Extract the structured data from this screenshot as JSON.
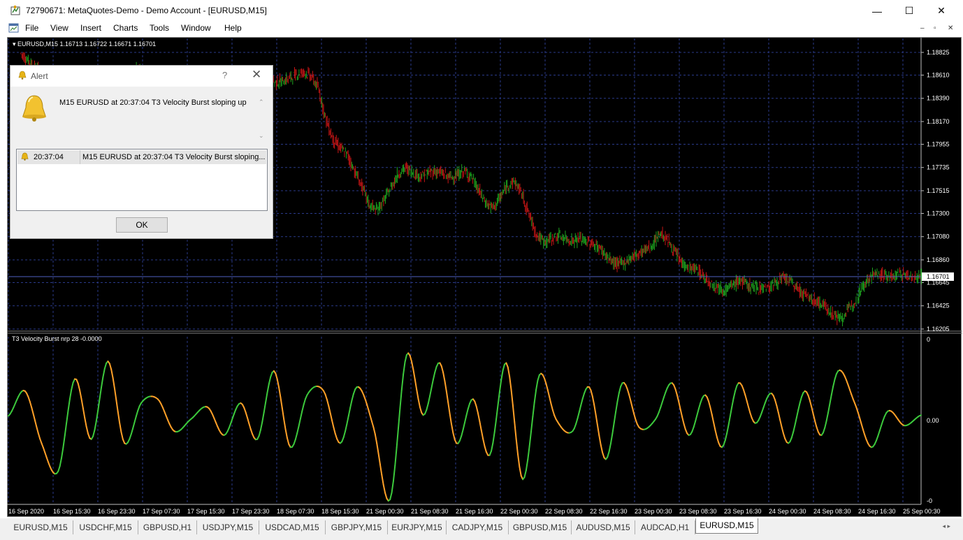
{
  "window": {
    "title": "72790671: MetaQuotes-Demo - Demo Account - [EURUSD,M15]",
    "minimize_glyph": "—",
    "maximize_glyph": "☐",
    "close_glyph": "✕"
  },
  "menu": {
    "items": [
      "File",
      "View",
      "Insert",
      "Charts",
      "Tools",
      "Window",
      "Help"
    ],
    "mdi": {
      "minimize": "–",
      "restore": "▫",
      "close": "✕"
    }
  },
  "chart": {
    "price_label": "EURUSD,M15  1.16713 1.16722 1.16671 1.16701",
    "current_price": "1.16701",
    "indicator_label": "T3 Velocity Burst nrp 28 -0.0000",
    "colors": {
      "background": "#000000",
      "bull": "#1ea51e",
      "bear": "#c71515",
      "grid": "#2a3a8a",
      "osc_up": "#3cc93c",
      "osc_down": "#ffa028"
    }
  },
  "chart_data": [
    {
      "type": "line",
      "title": "EURUSD,M15  1.16713 1.16722 1.16671 1.16701",
      "y_ticks": [
        "1.18825",
        "1.18610",
        "1.18390",
        "1.18170",
        "1.17955",
        "1.17735",
        "1.17515",
        "1.17300",
        "1.17080",
        "1.16860",
        "1.16645",
        "1.16425",
        "1.16205"
      ],
      "ylim": [
        1.16205,
        1.18825
      ],
      "current_price": 1.16701,
      "x_ticks": [
        "16 Sep 2020",
        "16 Sep 15:30",
        "16 Sep 23:30",
        "17 Sep 07:30",
        "17 Sep 15:30",
        "17 Sep 23:30",
        "18 Sep 07:30",
        "18 Sep 15:30",
        "21 Sep 00:30",
        "21 Sep 08:30",
        "21 Sep 16:30",
        "22 Sep 00:30",
        "22 Sep 08:30",
        "22 Sep 16:30",
        "23 Sep 00:30",
        "23 Sep 08:30",
        "23 Sep 16:30",
        "24 Sep 00:30",
        "24 Sep 08:30",
        "24 Sep 16:30",
        "25 Sep 00:30"
      ],
      "series": [
        {
          "name": "EURUSD,M15",
          "values": [
            1.1882,
            1.1875,
            1.1868,
            1.1865,
            1.1862,
            1.1864,
            1.1858,
            1.1853,
            1.185,
            1.1855,
            1.186,
            1.1856,
            1.185,
            1.1852,
            1.1858,
            1.1862,
            1.1866,
            1.1864,
            1.1859,
            1.1855,
            1.1857,
            1.186,
            1.1859,
            1.1854,
            1.1848,
            1.1846,
            1.185,
            1.1857,
            1.1862,
            1.1859,
            1.1853,
            1.1852,
            1.1856,
            1.186,
            1.1858,
            1.1854,
            1.1855,
            1.1858,
            1.1862,
            1.1864,
            1.186,
            1.1848,
            1.182,
            1.18,
            1.1792,
            1.1785,
            1.177,
            1.1755,
            1.1738,
            1.1733,
            1.1742,
            1.1755,
            1.1768,
            1.1773,
            1.1769,
            1.1765,
            1.1768,
            1.177,
            1.1768,
            1.1764,
            1.1766,
            1.177,
            1.1765,
            1.1752,
            1.174,
            1.1735,
            1.1745,
            1.1757,
            1.176,
            1.1748,
            1.1728,
            1.171,
            1.1703,
            1.1706,
            1.1709,
            1.1706,
            1.1704,
            1.1706,
            1.1703,
            1.17,
            1.1695,
            1.1686,
            1.1682,
            1.1683,
            1.1688,
            1.1692,
            1.1696,
            1.17,
            1.1712,
            1.1705,
            1.1693,
            1.1683,
            1.1678,
            1.1677,
            1.167,
            1.1664,
            1.166,
            1.1657,
            1.1662,
            1.1667,
            1.1662,
            1.166,
            1.166,
            1.166,
            1.1665,
            1.1669,
            1.1665,
            1.1658,
            1.1652,
            1.1648,
            1.1645,
            1.164,
            1.1633,
            1.163,
            1.164,
            1.165,
            1.1663,
            1.1671,
            1.1673,
            1.1671,
            1.167,
            1.1673,
            1.1671,
            1.167,
            1.167
          ]
        }
      ]
    },
    {
      "type": "line",
      "title": "T3 Velocity Burst nrp 28 -0.0000",
      "y_ticks": [
        "0",
        "0.00",
        "-0"
      ],
      "ylim": [
        -1,
        1
      ],
      "series": [
        {
          "name": "T3 Velocity Burst nrp 28",
          "values": [
            0.04,
            0.35,
            -0.3,
            -0.65,
            0.5,
            -0.25,
            0.72,
            -0.3,
            0.2,
            0.25,
            -0.15,
            0.0,
            0.15,
            -0.2,
            0.2,
            -0.25,
            0.6,
            -0.35,
            0.3,
            0.35,
            -0.3,
            0.4,
            -0.1,
            -1.0,
            0.8,
            0.05,
            0.7,
            -0.3,
            0.25,
            -0.45,
            0.7,
            -0.75,
            0.55,
            0.0,
            -0.15,
            0.4,
            -0.5,
            0.45,
            -0.1,
            0.0,
            0.45,
            -0.2,
            0.3,
            -0.35,
            0.45,
            -0.05,
            0.32,
            -0.3,
            0.35,
            -0.2,
            0.6,
            0.2,
            -0.35,
            0.1,
            -0.08,
            0.05
          ]
        }
      ]
    }
  ],
  "tabs": [
    "EURUSD,M15",
    "USDCHF,M15",
    "GBPUSD,H1",
    "USDJPY,M15",
    "USDCAD,M15",
    "GBPJPY,M15",
    "EURJPY,M15",
    "CADJPY,M15",
    "GBPUSD,M15",
    "AUDUSD,M15",
    "AUDCAD,H1",
    "EURUSD,M15"
  ],
  "active_tab_index": 11,
  "tab_scroll": "◂  ▸",
  "alert": {
    "title": "Alert",
    "help": "?",
    "close": "✕",
    "message": "M15 EURUSD at 20:37:04 T3 Velocity Burst  sloping up",
    "scroll_up": "⌃",
    "scroll_down": "⌄",
    "row_time": "20:37:04",
    "row_message": "M15 EURUSD at 20:37:04 T3 Velocity Burst  sloping...",
    "ok_label": "OK"
  }
}
